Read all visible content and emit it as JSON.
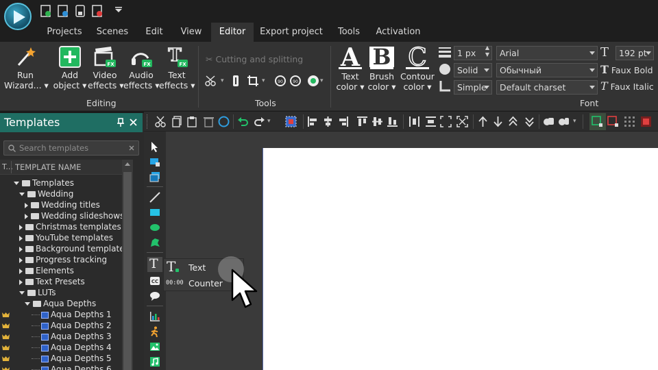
{
  "tabs": [
    "Projects",
    "Scenes",
    "Edit",
    "View",
    "Editor",
    "Export project",
    "Tools",
    "Activation"
  ],
  "active_tab": "Editor",
  "ribbon": {
    "run_wizard": [
      "Run",
      "Wizard..."
    ],
    "add_object": [
      "Add",
      "object"
    ],
    "video_effects": [
      "Video",
      "effects"
    ],
    "audio_effects": [
      "Audio",
      "effects"
    ],
    "text_effects": [
      "Text",
      "effects"
    ],
    "editing_label": "Editing",
    "cutting_splitting": "Cutting and splitting",
    "tools_label": "Tools",
    "text_color": [
      "Text",
      "color"
    ],
    "brush_color": [
      "Brush",
      "color"
    ],
    "contour_color": [
      "Contour",
      "color"
    ],
    "line_width": "1 px",
    "line_style": "Solid",
    "corner_style": "Simple",
    "font_name": "Arial",
    "font_style": "Обычный",
    "charset": "Default charset",
    "font_size": "192 pt",
    "faux_bold": "Faux Bold",
    "faux_italic": "Faux Italic",
    "font_label": "Font",
    "fx_badge": "FX"
  },
  "panel": {
    "title": "Templates",
    "search_placeholder": "Search templates",
    "col_type": "T...",
    "col_name": "TEMPLATE NAME"
  },
  "tree": [
    {
      "label": "Templates",
      "level": 0,
      "state": "open",
      "kind": "folder"
    },
    {
      "label": "Wedding",
      "level": 1,
      "state": "open",
      "kind": "folder"
    },
    {
      "label": "Wedding titles",
      "level": 2,
      "state": "closed",
      "kind": "folder"
    },
    {
      "label": "Wedding slideshows",
      "level": 2,
      "state": "closed",
      "kind": "folder"
    },
    {
      "label": "Christmas templates",
      "level": 1,
      "state": "closed",
      "kind": "folder"
    },
    {
      "label": "YouTube templates",
      "level": 1,
      "state": "closed",
      "kind": "folder"
    },
    {
      "label": "Background templates",
      "level": 1,
      "state": "closed",
      "kind": "folder"
    },
    {
      "label": "Progress tracking",
      "level": 1,
      "state": "closed",
      "kind": "folder"
    },
    {
      "label": "Elements",
      "level": 1,
      "state": "closed",
      "kind": "folder"
    },
    {
      "label": "Text Presets",
      "level": 1,
      "state": "closed",
      "kind": "folder"
    },
    {
      "label": "LUTs",
      "level": 1,
      "state": "open",
      "kind": "folder"
    },
    {
      "label": "Aqua Depths",
      "level": 2,
      "state": "open",
      "kind": "folder"
    },
    {
      "label": "Aqua Depths 1",
      "level": 3,
      "state": "none",
      "kind": "lut"
    },
    {
      "label": "Aqua Depths 2",
      "level": 3,
      "state": "none",
      "kind": "lut"
    },
    {
      "label": "Aqua Depths 3",
      "level": 3,
      "state": "none",
      "kind": "lut"
    },
    {
      "label": "Aqua Depths 4",
      "level": 3,
      "state": "none",
      "kind": "lut"
    },
    {
      "label": "Aqua Depths 5",
      "level": 3,
      "state": "none",
      "kind": "lut"
    },
    {
      "label": "Aqua Depths 6",
      "level": 3,
      "state": "none",
      "kind": "lut"
    }
  ],
  "popup": {
    "text_label": "Text",
    "counter_label": "Counter",
    "counter_icon": "00:00"
  },
  "colors": {
    "panel_header": "#1f6e63",
    "accent_green": "#27c26b",
    "accent_cyan": "#26c2e6"
  }
}
